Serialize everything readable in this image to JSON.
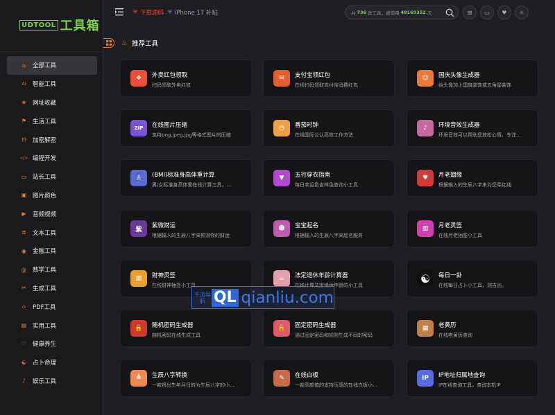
{
  "logo": {
    "box": "UDTOOL",
    "text": "工具箱"
  },
  "sidebar": {
    "items": [
      {
        "label": "全部工具",
        "icon": "home-icon",
        "active": true
      },
      {
        "label": "智能工具",
        "icon": "ai-icon"
      },
      {
        "label": "网址收藏",
        "icon": "bookmark-icon"
      },
      {
        "label": "生活工具",
        "icon": "flag-icon"
      },
      {
        "label": "加密解密",
        "icon": "lock-icon"
      },
      {
        "label": "编程开发",
        "icon": "code-icon"
      },
      {
        "label": "站长工具",
        "icon": "monitor-icon"
      },
      {
        "label": "图片颜色",
        "icon": "image-icon"
      },
      {
        "label": "音频视频",
        "icon": "play-icon"
      },
      {
        "label": "文本工具",
        "icon": "text-icon"
      },
      {
        "label": "金融工具",
        "icon": "coin-icon"
      },
      {
        "label": "数学工具",
        "icon": "at-icon"
      },
      {
        "label": "生成工具",
        "icon": "scissors-icon"
      },
      {
        "label": "PDF工具",
        "icon": "pdf-icon"
      },
      {
        "label": "实用工具",
        "icon": "toolbox-icon"
      },
      {
        "label": "健康养生",
        "icon": "heart-icon"
      },
      {
        "label": "占卜命理",
        "icon": "yinyang-icon"
      },
      {
        "label": "娱乐工具",
        "icon": "music-icon"
      }
    ]
  },
  "topbar": {
    "download": "下载源码",
    "iphone": "iPhone 17 补贴",
    "search": {
      "prefix": "共",
      "count": "736",
      "middle": "款工具，被使用",
      "uses": "48169352",
      "suffix": "次"
    }
  },
  "section": {
    "title": "推荐工具"
  },
  "colors": {
    "accent": "#e8792f",
    "brand": "#7bd24a"
  },
  "cards": [
    {
      "title": "外卖红包领取",
      "desc": "扫码领取外卖红包",
      "icon": "gift-icon",
      "color": "#ea4f3d",
      "glyph": "❖"
    },
    {
      "title": "支付宝领红包",
      "desc": "在线扫码领取支付宝消费红包",
      "icon": "redpacket-icon",
      "color": "#e0602f",
      "glyph": "✉"
    },
    {
      "title": "国庆头像生成器",
      "desc": "给头像加上国旗装饰或五角星装饰",
      "icon": "avatar-icon",
      "color": "#e87b3a",
      "glyph": "☺"
    },
    {
      "title": "在线图片压缩",
      "desc": "支持png,jpeg,jpg等格式图片的压缩",
      "icon": "zip-icon",
      "color": "#7a55d8",
      "glyph": "ZIP"
    },
    {
      "title": "番茄时钟",
      "desc": "在线国际公认高效工作方法",
      "icon": "tomato-icon",
      "color": "#f0a040",
      "glyph": "◷"
    },
    {
      "title": "环境音效生成器",
      "desc": "环境音效可以帮助您放松心情、专注…",
      "icon": "music-note-icon",
      "color": "#c86aa0",
      "glyph": "♪"
    },
    {
      "title": "(BMI)标准身高体重计算",
      "desc": "男/女标准身高体重在线计算工具，…",
      "icon": "scale-icon",
      "color": "#5a6ad0",
      "glyph": "♙"
    },
    {
      "title": "五行穿衣指南",
      "desc": "每日幸运色吉祥色查询小工具",
      "icon": "shirt-icon",
      "color": "#b04ad0",
      "glyph": "▼"
    },
    {
      "title": "月老姻缘",
      "desc": "根据输入的生辰八字来为您牵红线",
      "icon": "matchmaker-icon",
      "color": "#d03a3a",
      "glyph": "♥"
    },
    {
      "title": "紫微财运",
      "desc": "根据输入的生辰八字来预测你的财运",
      "icon": "ziwei-icon",
      "color": "#6a3a9a",
      "glyph": "紫"
    },
    {
      "title": "宝宝起名",
      "desc": "根据输入的生辰八字来起名服务",
      "icon": "baby-icon",
      "color": "#c05ab0",
      "glyph": "☻"
    },
    {
      "title": "月老灵签",
      "desc": "在线月老抽签小工具",
      "icon": "lottery-icon",
      "color": "#d040b0",
      "glyph": "▥"
    },
    {
      "title": "财神灵签",
      "desc": "在线财神抽签小工具",
      "icon": "fortune-stick-icon",
      "color": "#e8a030",
      "glyph": "▥"
    },
    {
      "title": "法定退休年龄计算器",
      "desc": "在线计算法定退休年龄的小工具",
      "icon": "coffee-icon",
      "color": "#e0a0b0",
      "glyph": "☕"
    },
    {
      "title": "每日一卦",
      "desc": "在线每日占卜小工具，测吉凶。",
      "icon": "yinyang-icon",
      "color": "#111111",
      "glyph": "☯"
    },
    {
      "title": "随机密码生成器",
      "desc": "随机密码在线生成工具",
      "icon": "lock-icon",
      "color": "#d03a2a",
      "glyph": "🔒"
    },
    {
      "title": "固定密码生成器",
      "desc": "通过固定密码和规则生成不同的密码",
      "icon": "lock-icon",
      "color": "#e05a6a",
      "glyph": "🔒"
    },
    {
      "title": "老黄历",
      "desc": "在线老黄历查询",
      "icon": "calendar-icon",
      "color": "#c0804a",
      "glyph": "▦"
    },
    {
      "title": "生辰八字转换",
      "desc": "一款将出生年月日转为生辰八字的小…",
      "icon": "pagoda-icon",
      "color": "#f08a50",
      "glyph": "≜"
    },
    {
      "title": "在线白板",
      "desc": "一款高颜值的支持压感的在线白板小…",
      "icon": "whiteboard-icon",
      "color": "#c86a4a",
      "glyph": "✎"
    },
    {
      "title": "IP地址归属地查询",
      "desc": "IP在线查询工具，查询本机IP",
      "icon": "ip-icon",
      "color": "#5a6ae0",
      "glyph": "IP"
    }
  ],
  "watermark": {
    "small": "千流导航",
    "ql": "QL",
    "domain": "qianliu.com"
  }
}
